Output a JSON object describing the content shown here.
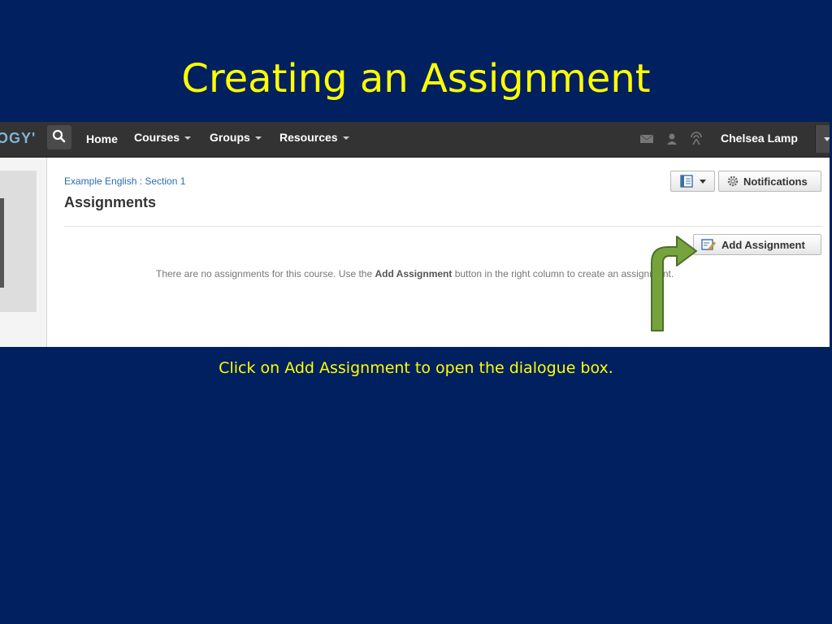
{
  "slide": {
    "title": "Creating an Assignment",
    "caption": "Click on Add Assignment to open the dialogue box."
  },
  "topnav": {
    "brand": "OGY'",
    "items": [
      {
        "label": "Home"
      },
      {
        "label": "Courses"
      },
      {
        "label": "Groups"
      },
      {
        "label": "Resources"
      }
    ],
    "user_name": "Chelsea Lamp"
  },
  "course": {
    "breadcrumb": "Example English : Section 1",
    "heading": "Assignments",
    "notifications_label": "Notifications",
    "add_assignment_label": "Add Assignment",
    "empty_before": "There are no assignments for this course. Use the ",
    "empty_bold": "Add Assignment",
    "empty_after": " button in the right column to create an assignment."
  },
  "colors": {
    "slide_background": "#002060",
    "title_text": "#ffff00",
    "arrow_fill": "#77a33f",
    "arrow_stroke": "#4e7026"
  },
  "icons": [
    "search-icon",
    "mail-icon",
    "people-icon",
    "signal-icon",
    "notebook-icon",
    "gear-icon",
    "edit-icon",
    "chevron-down-icon"
  ]
}
